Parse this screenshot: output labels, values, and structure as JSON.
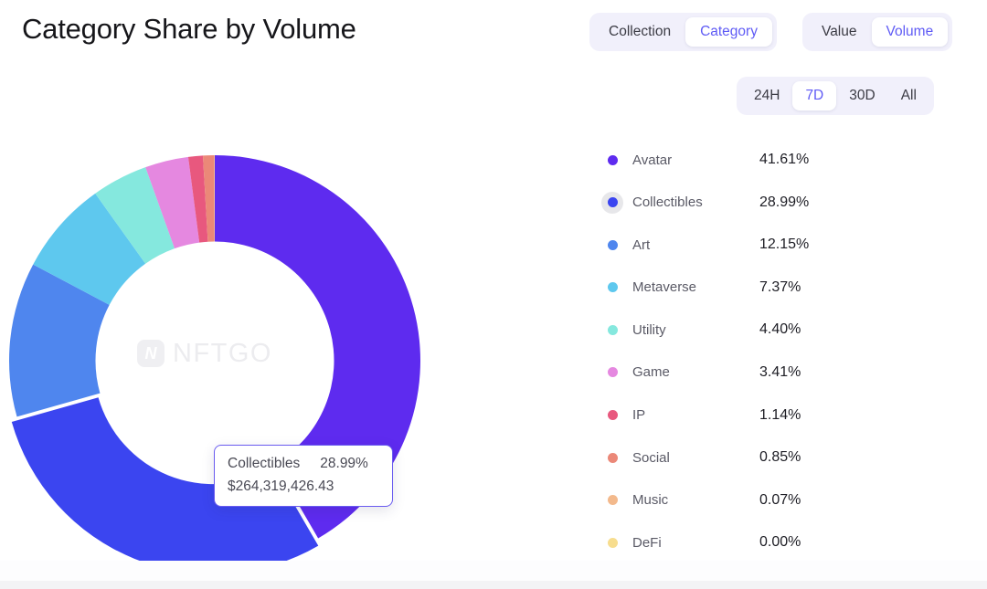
{
  "header": {
    "title": "Category Share by Volume"
  },
  "controls": {
    "entity_toggle": {
      "name": "entity-scope-toggle",
      "options": [
        "Collection",
        "Category"
      ],
      "active": "Category"
    },
    "metric_toggle": {
      "name": "metric-toggle",
      "options": [
        "Value",
        "Volume"
      ],
      "active": "Volume"
    },
    "range_toggle": {
      "name": "time-range-toggle",
      "options": [
        "24H",
        "7D",
        "30D",
        "All"
      ],
      "active": "7D"
    }
  },
  "watermark": {
    "badge_glyph": "N",
    "text": "NFTGO"
  },
  "tooltip": {
    "name": "Collectibles",
    "percent": "28.99%",
    "value": "$264,319,426.43",
    "border_color": "#6a5cf0"
  },
  "legend": {
    "highlighted": "Collectibles",
    "items": [
      {
        "label": "Avatar",
        "percent": "41.61%",
        "color": "#5e2bef"
      },
      {
        "label": "Collectibles",
        "percent": "28.99%",
        "color": "#3b45f0"
      },
      {
        "label": "Art",
        "percent": "12.15%",
        "color": "#4f86ee"
      },
      {
        "label": "Metaverse",
        "percent": "7.37%",
        "color": "#5ec8ee"
      },
      {
        "label": "Utility",
        "percent": "4.40%",
        "color": "#85e8de"
      },
      {
        "label": "Game",
        "percent": "3.41%",
        "color": "#e588e0"
      },
      {
        "label": "IP",
        "percent": "1.14%",
        "color": "#e8587e"
      },
      {
        "label": "Social",
        "percent": "0.85%",
        "color": "#eb8878"
      },
      {
        "label": "Music",
        "percent": "0.07%",
        "color": "#f3b98c"
      },
      {
        "label": "DeFi",
        "percent": "0.00%",
        "color": "#f7dd8e"
      }
    ]
  },
  "chart_data": {
    "type": "pie",
    "title": "Category Share by Volume",
    "subtitle": "",
    "unit": "percent",
    "donut": true,
    "inner_radius_ratio": 0.58,
    "start_angle_deg": -90,
    "direction": "clockwise",
    "legend_position": "right",
    "grid": false,
    "exploded_slice": "Collectibles",
    "categories": [
      "Avatar",
      "Collectibles",
      "Art",
      "Metaverse",
      "Utility",
      "Game",
      "IP",
      "Social",
      "Music",
      "DeFi"
    ],
    "values": [
      41.61,
      28.99,
      12.15,
      7.37,
      4.4,
      3.41,
      1.14,
      0.85,
      0.07,
      0.0
    ],
    "colors": [
      "#5e2bef",
      "#3b45f0",
      "#4f86ee",
      "#5ec8ee",
      "#85e8de",
      "#e588e0",
      "#e8587e",
      "#eb8878",
      "#f3b98c",
      "#f7dd8e"
    ],
    "labels": [
      "41.61%",
      "28.99%",
      "12.15%",
      "7.37%",
      "4.40%",
      "3.41%",
      "1.14%",
      "0.85%",
      "0.07%",
      "0.00%"
    ],
    "hovered": {
      "category": "Collectibles",
      "percent": 28.99,
      "value_usd": 264319426.43,
      "value_label": "$264,319,426.43"
    }
  }
}
